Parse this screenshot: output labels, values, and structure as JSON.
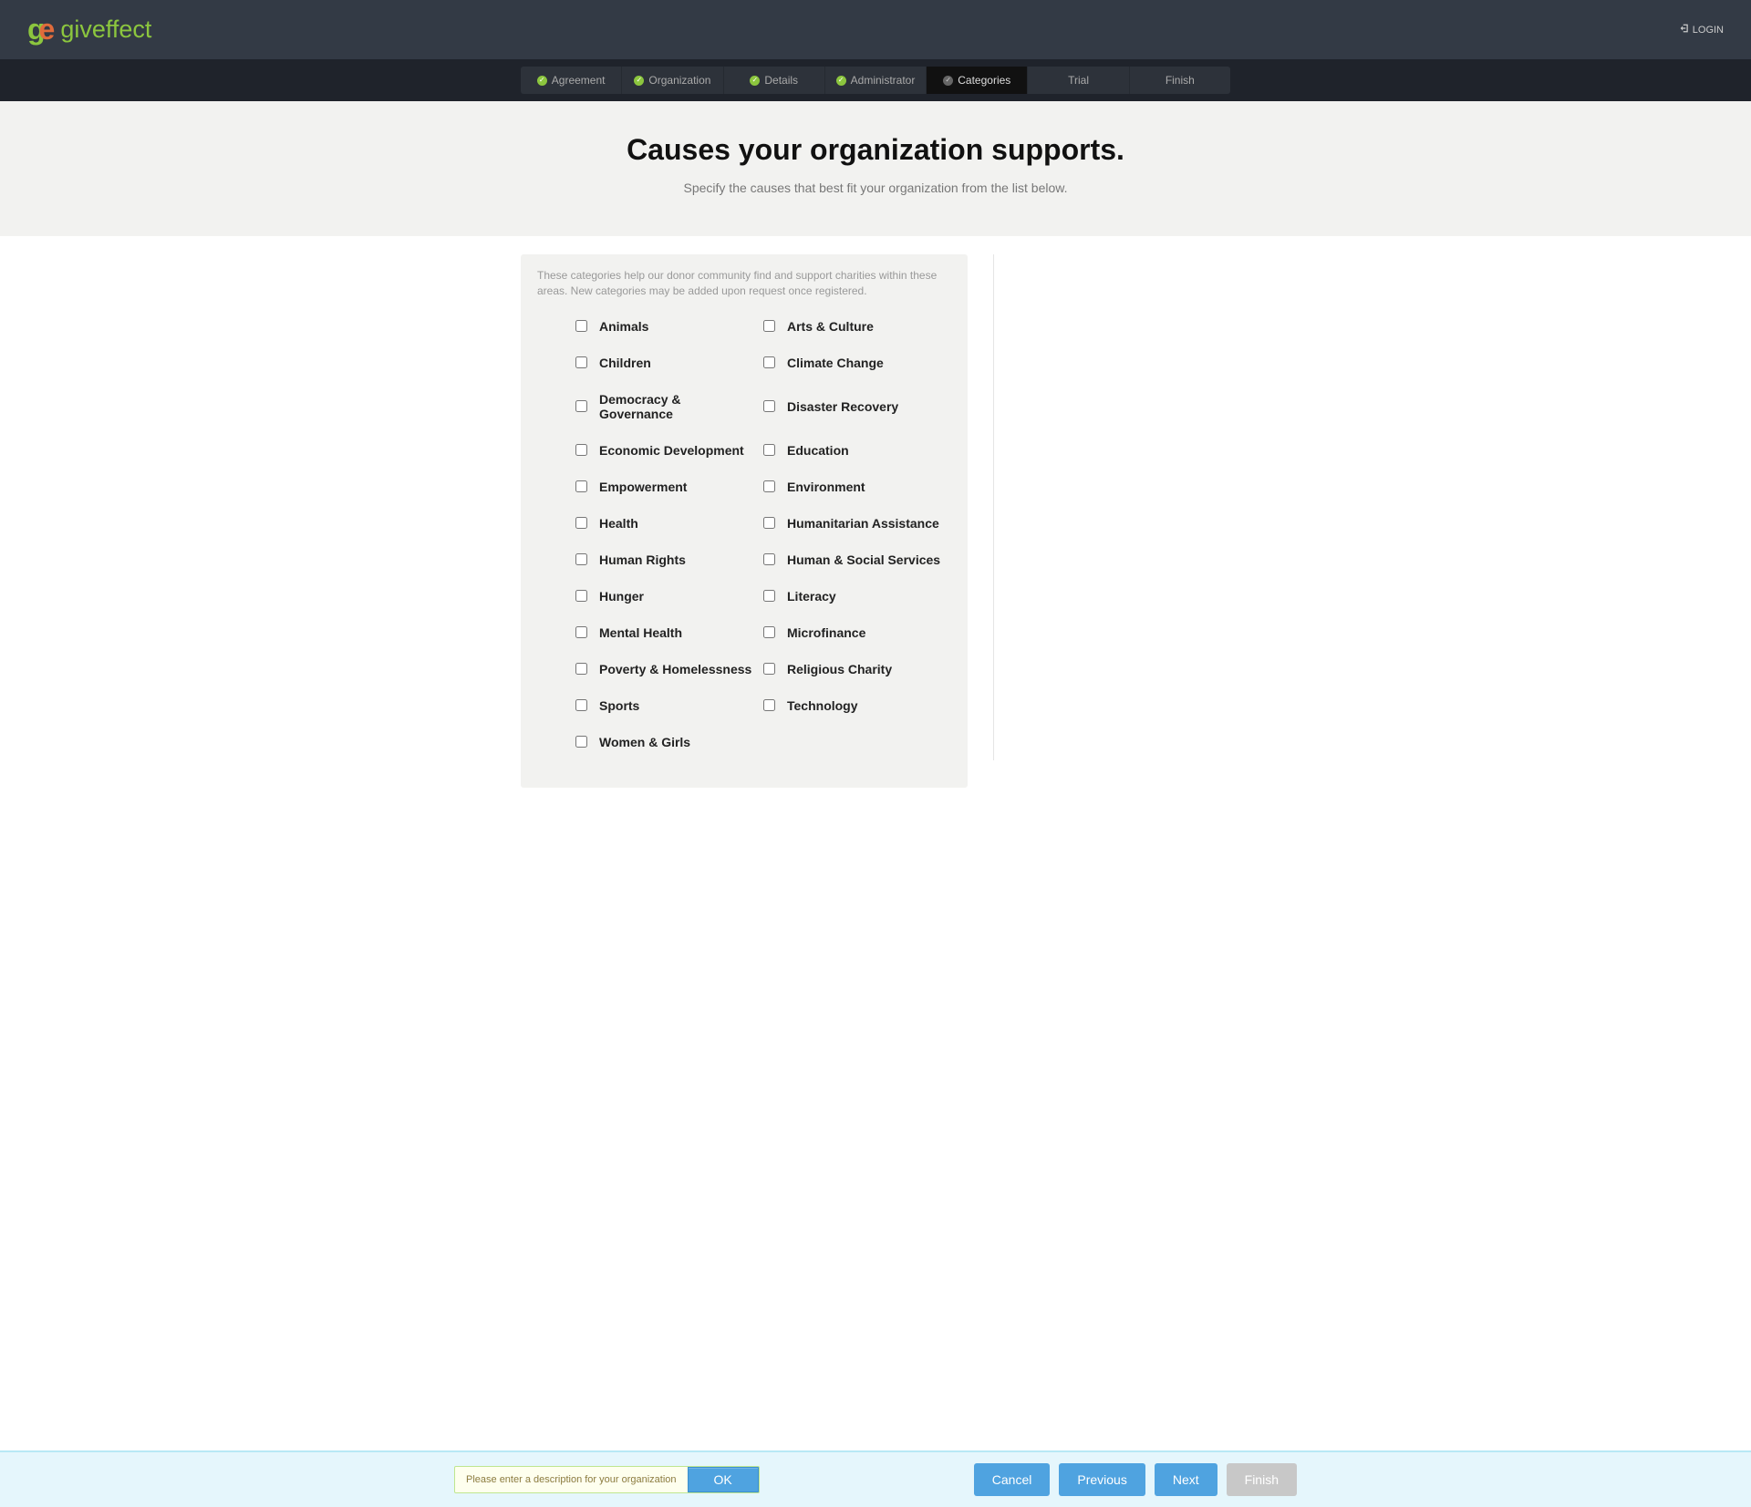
{
  "header": {
    "brand": "giveffect",
    "login_label": "LOGIN"
  },
  "progress": {
    "steps": [
      {
        "label": "Agreement",
        "state": "done"
      },
      {
        "label": "Organization",
        "state": "done"
      },
      {
        "label": "Details",
        "state": "done"
      },
      {
        "label": "Administrator",
        "state": "done"
      },
      {
        "label": "Categories",
        "state": "current"
      },
      {
        "label": "Trial",
        "state": "future"
      },
      {
        "label": "Finish",
        "state": "future"
      }
    ]
  },
  "title": {
    "heading": "Causes your organization supports.",
    "sub": "Specify the causes that best fit your organization from the list below."
  },
  "categories": {
    "description": "These categories help our donor community find and support charities within these areas. New categories may be added upon request once registered.",
    "items": [
      "Animals",
      "Arts & Culture",
      "Children",
      "Climate Change",
      "Democracy & Governance",
      "Disaster Recovery",
      "Economic Development",
      "Education",
      "Empowerment",
      "Environment",
      "Health",
      "Humanitarian Assistance",
      "Human Rights",
      "Human & Social Services",
      "Hunger",
      "Literacy",
      "Mental Health",
      "Microfinance",
      "Poverty & Homelessness",
      "Religious Charity",
      "Sports",
      "Technology",
      "Women & Girls"
    ]
  },
  "bottom": {
    "validation_message": "Please enter a description for your organization",
    "ok_label": "OK",
    "cancel_label": "Cancel",
    "previous_label": "Previous",
    "next_label": "Next",
    "finish_label": "Finish"
  }
}
